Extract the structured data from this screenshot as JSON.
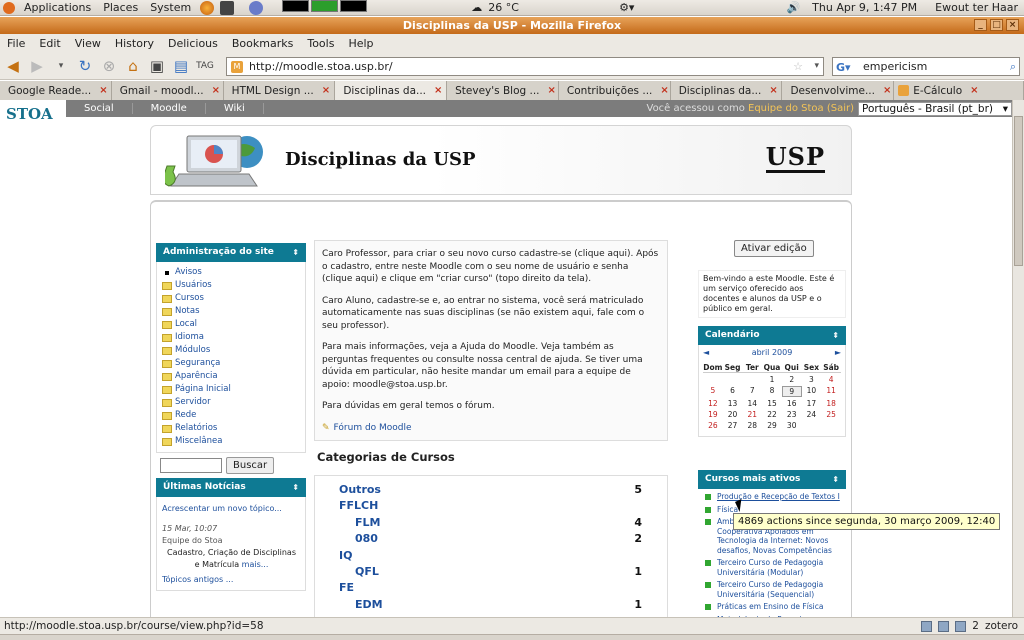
{
  "gnome_panel": {
    "menus": [
      "Applications",
      "Places",
      "System"
    ],
    "weather": "26 °C",
    "datetime": "Thu Apr  9,  1:47 PM",
    "user": "Ewout ter Haar"
  },
  "window": {
    "title": "Disciplinas da USP - Mozilla Firefox"
  },
  "menubar": [
    "File",
    "Edit",
    "View",
    "History",
    "Delicious",
    "Bookmarks",
    "Tools",
    "Help"
  ],
  "navbar": {
    "url": "http://moodle.stoa.usp.br/",
    "search_value": "empericism"
  },
  "tabs": [
    {
      "label": "Google Reade...",
      "color": "#3d7bd8"
    },
    {
      "label": "Gmail - moodl...",
      "color": "#d33b2c"
    },
    {
      "label": "HTML Design ...",
      "color": "#888888"
    },
    {
      "label": "Disciplinas da...",
      "color": "#e9a23b"
    },
    {
      "label": "Stevey's Blog ...",
      "color": "#f07d1f"
    },
    {
      "label": "Contribuições ...",
      "color": "#2a6fb5"
    },
    {
      "label": "Disciplinas da...",
      "color": "#e9a23b"
    },
    {
      "label": "Desenvolvime...",
      "color": "#5a5a5a"
    },
    {
      "label": "E-Cálculo",
      "color": "#e9a23b"
    }
  ],
  "stoa_bar": {
    "links": [
      "Social",
      "Moodle",
      "Wiki"
    ],
    "access_prefix": "Você acessou como",
    "access_user": "Equipe do Stoa",
    "access_exit": "(Sair)",
    "language": "Português - Brasil (pt_br)"
  },
  "site": {
    "logo": "STOA",
    "title": "Disciplinas da USP",
    "usp_logo": "USP"
  },
  "admin_block": {
    "title": "Administração do site",
    "items": [
      "Avisos",
      "Usuários",
      "Cursos",
      "Notas",
      "Local",
      "Idioma",
      "Módulos",
      "Segurança",
      "Aparência",
      "Página Inicial",
      "Servidor",
      "Rede",
      "Relatórios",
      "Miscelânea"
    ],
    "search_button": "Buscar"
  },
  "news_block": {
    "title": "Últimas Notícias",
    "add_link": "Acrescentar um novo tópico...",
    "date": "15 Mar, 10:07",
    "author": "Equipe do Stoa",
    "headline": "Cadastro, Criação de Disciplinas e Matrícula",
    "more": "mais...",
    "older": "Tópicos antigos ..."
  },
  "intro": {
    "p1": "Caro Professor, para criar o seu novo curso cadastre-se (clique aqui). Após o cadastro, entre neste Moodle com o seu nome de usuário e senha (clique aqui) e clique em \"criar curso\" (topo direito da tela).",
    "p2": "Caro Aluno, cadastre-se e, ao entrar no sistema, você será matriculado automaticamente nas suas disciplinas (se não existem aqui, fale com o seu professor).",
    "p3": "Para mais informações, veja a Ajuda do Moodle. Veja também as perguntas frequentes ou consulte nossa central de ajuda. Se tiver uma dúvida em particular, não hesite mandar um email para a equipe de apoio: moodle@stoa.usp.br.",
    "p4": "Para dúvidas em geral temos o fórum.",
    "forum_link": "Fórum do Moodle"
  },
  "categories": {
    "title": "Categorias de Cursos",
    "rows": [
      {
        "name": "Outros",
        "count": "5",
        "indent": 0
      },
      {
        "name": "FFLCH",
        "count": "",
        "indent": 0
      },
      {
        "name": "FLM",
        "count": "4",
        "indent": 1
      },
      {
        "name": "080",
        "count": "2",
        "indent": 1
      },
      {
        "name": "IQ",
        "count": "",
        "indent": 0
      },
      {
        "name": "QFL",
        "count": "1",
        "indent": 1
      },
      {
        "name": "FE",
        "count": "",
        "indent": 0
      },
      {
        "name": "EDM",
        "count": "1",
        "indent": 1
      }
    ]
  },
  "right": {
    "edit_button": "Ativar edição",
    "welcome": "Bem-vindo a este Moodle. Este é um serviço oferecido aos docentes e alunos da USP e o público em geral.",
    "calendar": {
      "title": "Calendário",
      "prev": "◄",
      "month": "abril 2009",
      "next": "►",
      "days": [
        "Dom",
        "Seg",
        "Ter",
        "Qua",
        "Qui",
        "Sex",
        "Sáb"
      ],
      "cells": [
        "",
        "",
        "",
        "1",
        "2",
        "3",
        "4",
        "5",
        "6",
        "7",
        "8",
        "9",
        "10",
        "11",
        "12",
        "13",
        "14",
        "15",
        "16",
        "17",
        "18",
        "19",
        "20",
        "21",
        "22",
        "23",
        "24",
        "25",
        "26",
        "27",
        "28",
        "29",
        "30",
        "",
        ""
      ]
    },
    "active_courses": {
      "title": "Cursos mais ativos",
      "items": [
        "Produção e Recepção de Textos I",
        "Física",
        "Ambientes Colaborativos: Cooperativa Apoiados em Tecnologia da Internet: Novos desafios, Novas Competências",
        "Terceiro Curso de Pedagogia Universitária (Modular)",
        "Terceiro Curso de Pedagogia Universitária (Sequencial)",
        "Práticas em Ensino de Física",
        "Metodologia de Pesquisa em Etologia"
      ]
    }
  },
  "tooltip": "4869 actions since segunda,  30 março 2009, 12:40",
  "statusbar": {
    "url": "http://moodle.stoa.usp.br/course/view.php?id=58",
    "right_text": "zotero",
    "count": "2"
  }
}
